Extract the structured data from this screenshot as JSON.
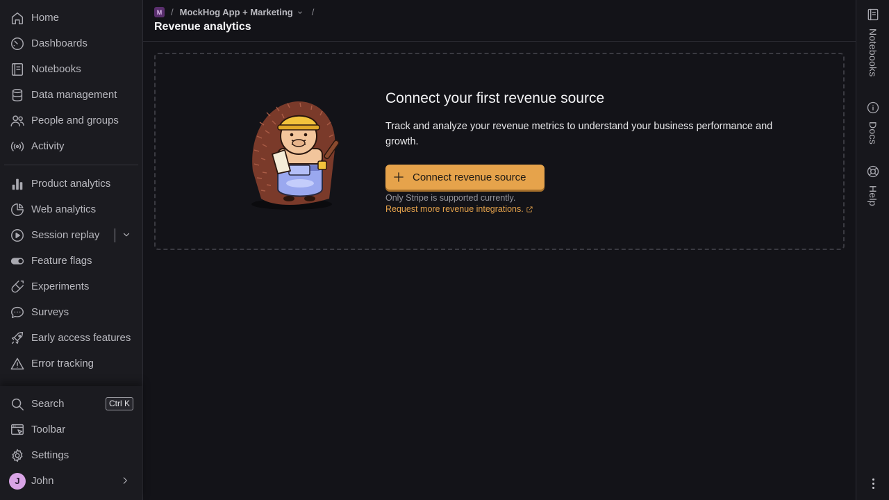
{
  "sidebar": {
    "items": [
      {
        "label": "Home",
        "icon": "home-icon"
      },
      {
        "label": "Dashboards",
        "icon": "dashboard-icon"
      },
      {
        "label": "Notebooks",
        "icon": "notebook-icon"
      },
      {
        "label": "Data management",
        "icon": "database-icon"
      },
      {
        "label": "People and groups",
        "icon": "people-icon"
      },
      {
        "label": "Activity",
        "icon": "activity-icon"
      },
      {
        "label": "Product analytics",
        "icon": "bar-chart-icon"
      },
      {
        "label": "Web analytics",
        "icon": "pie-chart-icon"
      },
      {
        "label": "Session replay",
        "icon": "play-circle-icon"
      },
      {
        "label": "Feature flags",
        "icon": "toggle-icon"
      },
      {
        "label": "Experiments",
        "icon": "flask-icon"
      },
      {
        "label": "Surveys",
        "icon": "chat-bubble-icon"
      },
      {
        "label": "Early access features",
        "icon": "rocket-icon"
      },
      {
        "label": "Error tracking",
        "icon": "warning-icon"
      }
    ],
    "bottom": {
      "search_label": "Search",
      "search_shortcut": "Ctrl K",
      "toolbar_label": "Toolbar",
      "settings_label": "Settings",
      "user_name": "John",
      "user_initial": "J",
      "avatar_color": "#d9a4e6"
    }
  },
  "header": {
    "project_initial": "M",
    "project_name": "MockHog App + Marketing",
    "separator": "/",
    "title": "Revenue analytics"
  },
  "right_rail": {
    "notebooks_label": "Notebooks",
    "docs_label": "Docs",
    "help_label": "Help"
  },
  "empty_state": {
    "title": "Connect your first revenue source",
    "description": "Track and analyze your revenue metrics to understand your business performance and growth.",
    "button_label": "Connect revenue source",
    "note": "Only Stripe is supported currently.",
    "link_label": "Request more revenue integrations."
  },
  "colors": {
    "accent": "#e6a34b",
    "background": "#131318",
    "sidebar_bg": "#1b1b20"
  }
}
